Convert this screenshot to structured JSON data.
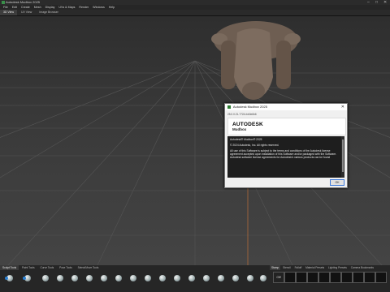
{
  "window": {
    "title": "Autodesk Mudbox 2025",
    "controls": {
      "minimize": "–",
      "maximize": "□",
      "close": "✕"
    }
  },
  "menu": [
    "File",
    "Edit",
    "Create",
    "Mesh",
    "Display",
    "UVs & Maps",
    "Render",
    "Windows",
    "Help"
  ],
  "view_tabs": [
    "3D View",
    "UV View",
    "Image Browser"
  ],
  "dialog": {
    "title": "Autodesk Mudbox 2025",
    "close": "✕",
    "version": "25.0.0.21-7724-fcb0e6b6",
    "logo_main": "AUTODESK",
    "logo_sub": "Mudbox",
    "product": "Autodesk® Mudbox® 2025",
    "copyright": "© 2024 Autodesk, Inc.  All rights reserved.",
    "license": "All use of this Software is subject to the terms and conditions of the Autodesk license agreement accepted upon installation of this Software and/or packaged with the Software.  Autodesk software license agreements for Autodesk's various products can be found",
    "ok_label": "OK"
  },
  "shelf_tabs": [
    "Sculpt Tools",
    "Paint Tools",
    "Curve Tools",
    "Pose Tools",
    "Select/Move Tools"
  ],
  "shelf_tabs_right": [
    "Stamp",
    "Stencil",
    "Falloff",
    "Material Presets",
    "Lighting Presets",
    "Camera Bookmarks"
  ],
  "stamp_off_label": "Off",
  "colors": {
    "background": "#1c1c1c",
    "viewport": "#3a3a3a",
    "dialog": "#f0f0f0",
    "accent": "#2a7fd1"
  }
}
